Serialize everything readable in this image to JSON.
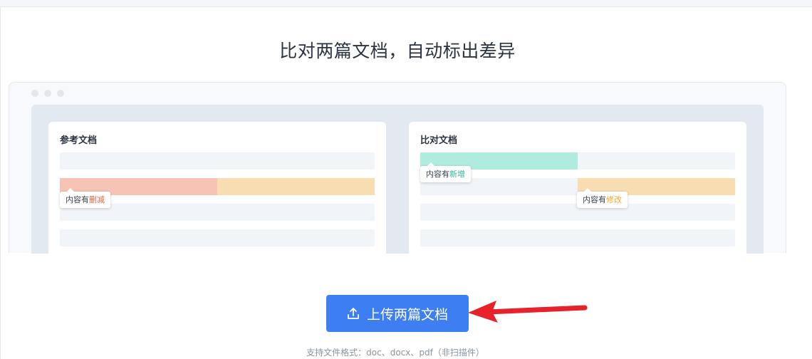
{
  "headline": "比对两篇文档，自动标出差异",
  "reference_doc": {
    "title": "参考文档",
    "tag_prefix": "内容有",
    "tag_keyword": "删减"
  },
  "compare_doc": {
    "title": "比对文档",
    "tag_add_prefix": "内容有",
    "tag_add_keyword": "新增",
    "tag_mod_prefix": "内容有",
    "tag_mod_keyword": "修改"
  },
  "upload": {
    "icon": "upload-icon",
    "label": "上传两篇文档"
  },
  "formats_note": "支持文件格式：doc、docx、pdf（非扫描件）",
  "colors": {
    "primary": "#3d7ff3",
    "deleted": "#f6c3b4",
    "added": "#b0ebe0",
    "modified": "#f8ddb3",
    "arrow": "#e8222a"
  }
}
